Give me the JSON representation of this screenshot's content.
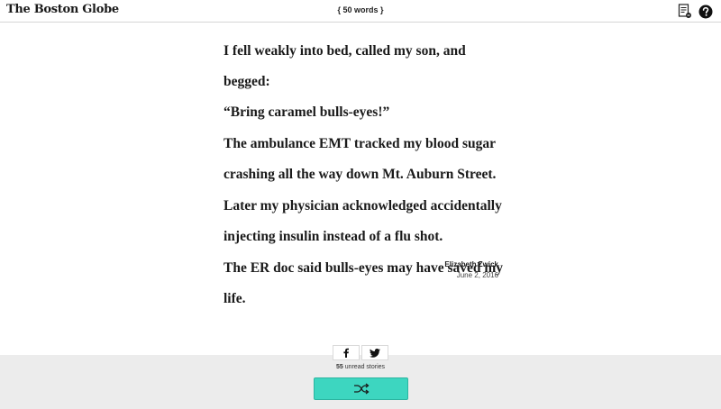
{
  "header": {
    "logo": "The Boston Globe",
    "word_count": "{ 50 words }",
    "icons": [
      "story-list-icon",
      "help-icon"
    ]
  },
  "story": {
    "paragraphs": [
      "I fell weakly into bed, called my son, and begged:",
      "“Bring caramel bulls-eyes!”",
      "The ambulance EMT tracked my blood sugar",
      "crashing all the way down Mt. Auburn Street.",
      "Later my physician acknowledged accidentally",
      "injecting insulin instead of a flu shot.",
      "The ER doc said bulls-eyes may have saved my life."
    ],
    "author": "Elizabeth Zwick",
    "date": "June 2, 2016"
  },
  "footer": {
    "share": [
      "facebook-icon",
      "twitter-icon"
    ],
    "unread_count": "55",
    "unread_label": "unread stories",
    "shuffle_icon": "shuffle-icon",
    "accent_color": "#3dd6c0"
  }
}
